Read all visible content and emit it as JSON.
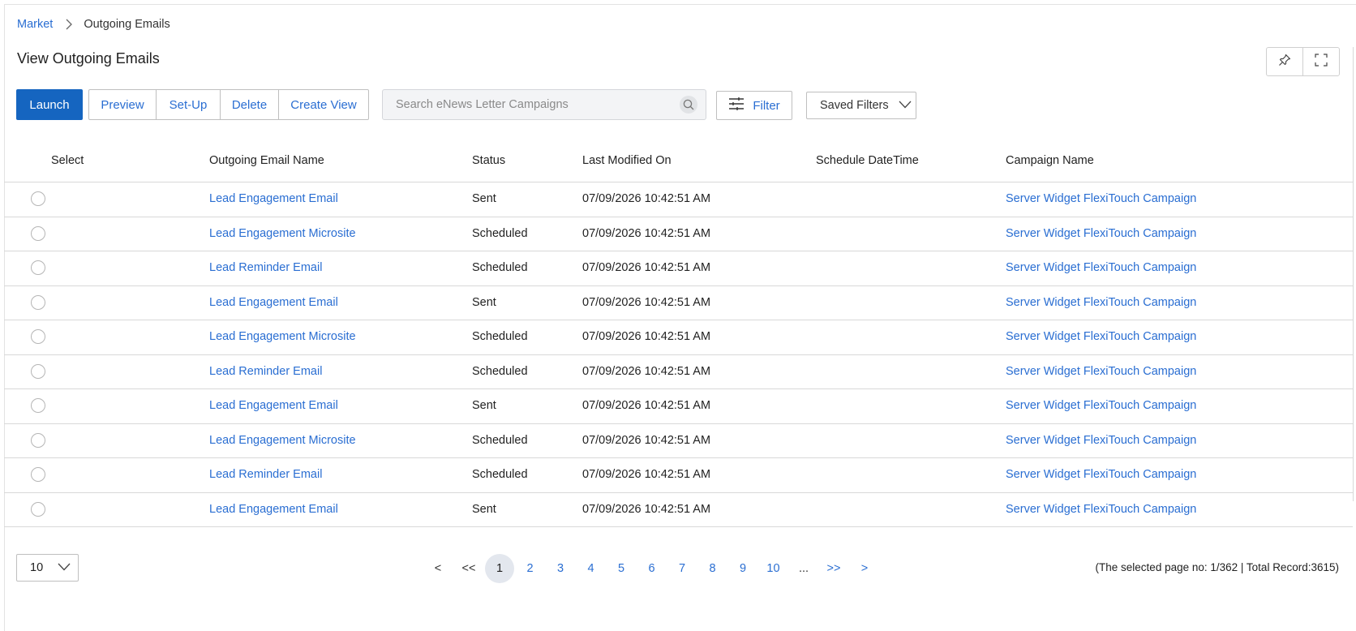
{
  "breadcrumb": {
    "parent": "Market",
    "current": "Outgoing Emails"
  },
  "page_title": "View Outgoing Emails",
  "toolbar": {
    "launch": "Launch",
    "preview": "Preview",
    "setup": "Set-Up",
    "delete": "Delete",
    "create_view": "Create View",
    "search_placeholder": "Search eNews Letter Campaigns",
    "filter": "Filter",
    "saved_filters": "Saved Filters"
  },
  "icons": {
    "breadcrumb_sep": "chevron-right-icon",
    "pin": "pin-icon",
    "fullscreen": "fullscreen-icon",
    "search": "search-icon",
    "filter": "sliders-icon",
    "dropdown": "chevron-down-icon"
  },
  "colors": {
    "primary": "#1565c0",
    "link": "#2a6ed2",
    "border": "#d8d8d8"
  },
  "table": {
    "columns": {
      "select": "Select",
      "name": "Outgoing Email Name",
      "status": "Status",
      "modified": "Last Modified On",
      "schedule": "Schedule DateTime",
      "campaign": "Campaign Name"
    },
    "rows": [
      {
        "name": "Lead Engagement Email",
        "status": "Sent",
        "modified": "07/09/2026 10:42:51 AM",
        "schedule": "",
        "campaign": "Server Widget FlexiTouch Campaign"
      },
      {
        "name": "Lead Engagement Microsite",
        "status": "Scheduled",
        "modified": "07/09/2026 10:42:51 AM",
        "schedule": "",
        "campaign": "Server Widget FlexiTouch Campaign"
      },
      {
        "name": "Lead Reminder Email",
        "status": "Scheduled",
        "modified": "07/09/2026 10:42:51 AM",
        "schedule": "",
        "campaign": "Server Widget FlexiTouch Campaign"
      },
      {
        "name": "Lead Engagement Email",
        "status": "Sent",
        "modified": "07/09/2026 10:42:51 AM",
        "schedule": "",
        "campaign": "Server Widget FlexiTouch Campaign"
      },
      {
        "name": "Lead Engagement Microsite",
        "status": "Scheduled",
        "modified": "07/09/2026 10:42:51 AM",
        "schedule": "",
        "campaign": "Server Widget FlexiTouch Campaign"
      },
      {
        "name": "Lead Reminder Email",
        "status": "Scheduled",
        "modified": "07/09/2026 10:42:51 AM",
        "schedule": "",
        "campaign": "Server Widget FlexiTouch Campaign"
      },
      {
        "name": "Lead Engagement Email",
        "status": "Sent",
        "modified": "07/09/2026 10:42:51 AM",
        "schedule": "",
        "campaign": "Server Widget FlexiTouch Campaign"
      },
      {
        "name": "Lead Engagement Microsite",
        "status": "Scheduled",
        "modified": "07/09/2026 10:42:51 AM",
        "schedule": "",
        "campaign": "Server Widget FlexiTouch Campaign"
      },
      {
        "name": "Lead Reminder Email",
        "status": "Scheduled",
        "modified": "07/09/2026 10:42:51 AM",
        "schedule": "",
        "campaign": "Server Widget FlexiTouch Campaign"
      },
      {
        "name": "Lead Engagement Email",
        "status": "Sent",
        "modified": "07/09/2026 10:42:51 AM",
        "schedule": "",
        "campaign": "Server Widget FlexiTouch Campaign"
      }
    ]
  },
  "pagination": {
    "page_size": "10",
    "prev": "<",
    "first": "<<",
    "pages": [
      "1",
      "2",
      "3",
      "4",
      "5",
      "6",
      "7",
      "8",
      "9",
      "10"
    ],
    "ellipsis": "...",
    "last": ">>",
    "next": ">",
    "active_page": "1",
    "record_info": "(The selected page no: 1/362 | Total Record:3615)"
  }
}
